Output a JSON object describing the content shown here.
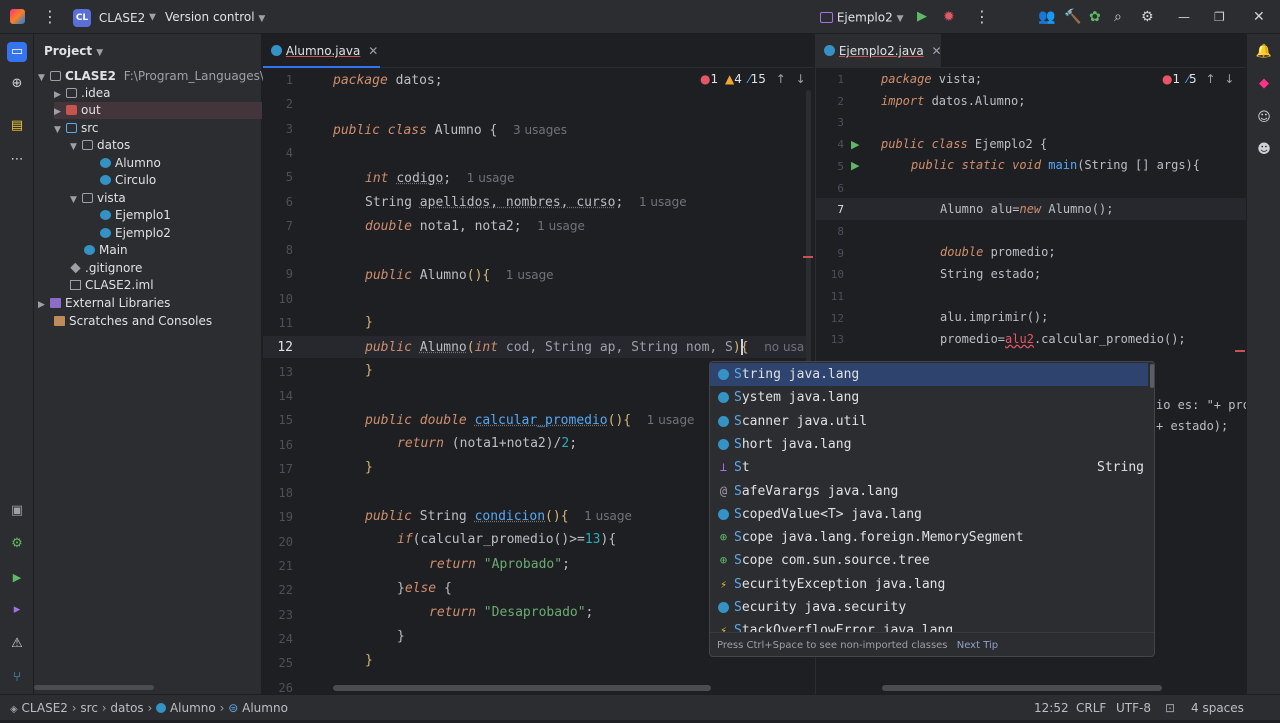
{
  "topbar": {
    "project_badge": "CL",
    "project_name": "CLASE2",
    "vcs": "Version control",
    "run_config": "Ejemplo2"
  },
  "project_panel": {
    "title": "Project",
    "root_name": "CLASE2",
    "root_path": "F:\\Program_Languages\\JAV",
    "items": [
      ".idea",
      "out",
      "src",
      "datos",
      "Alumno",
      "Circulo",
      "vista",
      "Ejemplo1",
      "Ejemplo2",
      "Main",
      ".gitignore",
      "CLASE2.iml",
      "External Libraries",
      "Scratches and Consoles"
    ]
  },
  "editor1": {
    "tab": "Alumno.java",
    "inspections": {
      "errors": "1",
      "warnings": "4",
      "weak": "15"
    },
    "lines": [
      "1",
      "2",
      "3",
      "4",
      "5",
      "6",
      "7",
      "8",
      "9",
      "10",
      "11",
      "12",
      "13",
      "14",
      "15",
      "16",
      "17",
      "18",
      "19",
      "20",
      "21",
      "22",
      "23",
      "24",
      "25",
      "26"
    ],
    "code": {
      "l1a": "package",
      "l1b": " datos;",
      "l3a": "public class ",
      "l3b": "Alumno",
      "l3c": " {",
      "l3h": "3 usages",
      "l5a": "int ",
      "l5b": "codigo",
      "l5c": ";",
      "l5h": "1 usage",
      "l6a": "String ",
      "l6b": "apellidos, nombres, curso",
      "l6c": ";",
      "l6h": "1 usage",
      "l7a": "double ",
      "l7b": "nota1, nota2;",
      "l7h": "1 usage",
      "l9a": "public ",
      "l9b": "Alumno",
      "l9c": "(){",
      "l9h": "1 usage",
      "l11": "}",
      "l12a": "public ",
      "l12b": "Alumno",
      "l12c": "(",
      "l12d": "int ",
      "l12e": "cod, String ap, String nom, S",
      "l12f": "){",
      "l12h": "no usa",
      "l13": "}",
      "l15a": "public double ",
      "l15b": "calcular_promedio",
      "l15c": "(){",
      "l15h": "1 usage",
      "l16a": "return ",
      "l16b": "(nota1+nota2)/",
      "l16c": "2",
      "l16d": ";",
      "l17": "}",
      "l19a": "public ",
      "l19b": "String ",
      "l19c": "condicion",
      "l19d": "(){",
      "l19h": "1 usage",
      "l20a": "if",
      "l20b": "(calcular_promedio()>=",
      "l20c": "13",
      "l20d": "){",
      "l21a": "return ",
      "l21b": "\"Aprobado\"",
      "l21c": ";",
      "l22a": "}",
      "l22b": "else",
      "l22c": " {",
      "l23a": "return ",
      "l23b": "\"Desaprobado\"",
      "l23c": ";",
      "l24": "}",
      "l25": "}"
    }
  },
  "editor2": {
    "tab": "Ejemplo2.java",
    "inspections": {
      "errors": "1",
      "warnings": "5"
    },
    "lines": [
      "1",
      "2",
      "3",
      "4",
      "5",
      "6",
      "7",
      "8",
      "9",
      "10",
      "11",
      "12",
      "13"
    ],
    "code": {
      "l1a": "package ",
      "l1b": "vista;",
      "l2a": "import ",
      "l2b": "datos.Alumno;",
      "l4a": "public class ",
      "l4b": "Ejemplo2 {",
      "l5a": "public static void ",
      "l5b": "main",
      "l5c": "(String [] args){",
      "l7a": "Alumno alu=",
      "l7b": "new ",
      "l7c": "Alumno();",
      "l9a": "double ",
      "l9b": "promedio;",
      "l10a": "String ",
      "l10b": "estado;",
      "l12": "alu.imprimir();",
      "l13a": "promedio=",
      "l13b": "alu2",
      ".l13c": "",
      "l13c": ".calcular_promedio();",
      "frag1": "io es: \"+ pro",
      "frag2": "+ estado);"
    }
  },
  "completion": {
    "items": [
      {
        "icon": "c",
        "bold": "S",
        "rest": "tring java.lang"
      },
      {
        "icon": "c",
        "bold": "S",
        "rest": "ystem java.lang"
      },
      {
        "icon": "c",
        "bold": "S",
        "rest": "canner java.util"
      },
      {
        "icon": "c",
        "bold": "S",
        "rest": "hort java.lang"
      },
      {
        "icon": "p",
        "bold": "S",
        "rest": "t",
        "type": "String"
      },
      {
        "icon": "@",
        "bold": "S",
        "rest": "afeVarargs java.lang"
      },
      {
        "icon": "c",
        "bold": "S",
        "rest": "copedValue<T> java.lang"
      },
      {
        "icon": "i",
        "bold": "S",
        "rest": "cope java.lang.foreign.MemorySegment"
      },
      {
        "icon": "i",
        "bold": "S",
        "rest": "cope com.sun.source.tree"
      },
      {
        "icon": "e",
        "bold": "S",
        "rest": "ecurityException java.lang"
      },
      {
        "icon": "c",
        "bold": "S",
        "rest": "ecurity java.security"
      },
      {
        "icon": "e",
        "bold": "S",
        "rest": "tackOverflowError java.lang"
      }
    ],
    "footer": "Press Ctrl+Space to see non-imported classes",
    "next_tip": "Next Tip"
  },
  "statusbar": {
    "crumbs": [
      "CLASE2",
      "src",
      "datos",
      "Alumno",
      "Alumno"
    ],
    "position": "12:52",
    "line_sep": "CRLF",
    "encoding": "UTF-8",
    "indent": "4 spaces"
  }
}
